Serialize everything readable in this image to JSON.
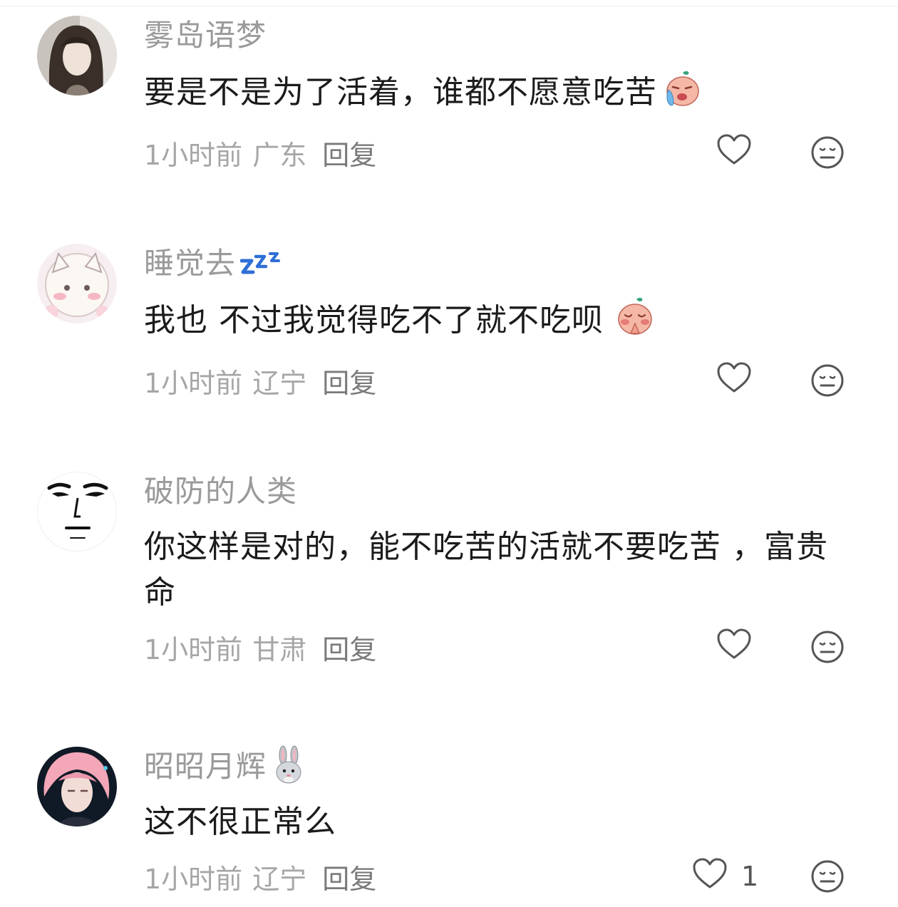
{
  "comments": [
    {
      "username": "雾岛语梦",
      "text": "要是不是为了活着，谁都不愿意吃苦",
      "time": "1小时前",
      "location": "广东",
      "reply_label": "回复",
      "like_count": "",
      "emoji": "crying-face-emoji"
    },
    {
      "username": "睡觉去",
      "text": "我也 不过我觉得吃不了就不吃呗",
      "time": "1小时前",
      "location": "辽宁",
      "reply_label": "回复",
      "like_count": "",
      "emoji": "praying-face-emoji"
    },
    {
      "username": "破防的人类",
      "text": "你这样是对的，能不吃苦的活就不要吃苦 ，富贵命",
      "time": "1小时前",
      "location": "甘肃",
      "reply_label": "回复",
      "like_count": ""
    },
    {
      "username": "昭昭月辉",
      "text": "这不很正常么",
      "time": "1小时前",
      "location": "辽宁",
      "reply_label": "回复",
      "like_count": "1"
    }
  ],
  "colors": {
    "username": "#9a9a9a",
    "text": "#1b1b1b",
    "meta": "#a6a6a6",
    "icon_stroke": "#555555"
  }
}
